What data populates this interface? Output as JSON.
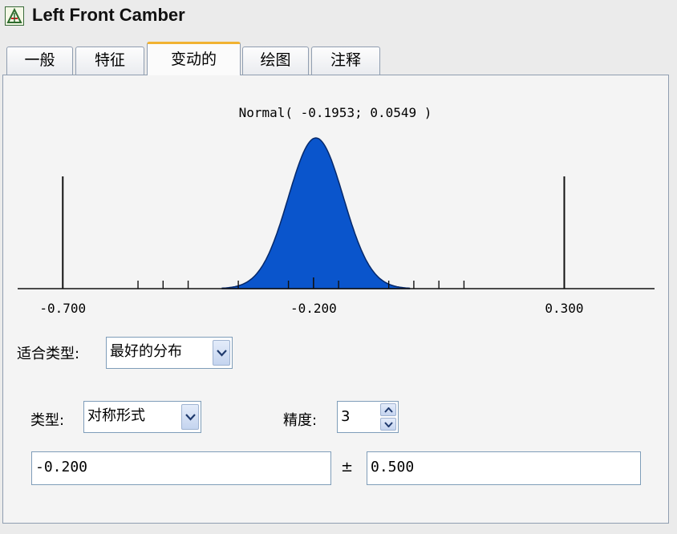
{
  "window": {
    "title": "Left Front Camber",
    "icon": "tolerance-chart-icon"
  },
  "tabs": [
    {
      "label": "一般",
      "active": false
    },
    {
      "label": "特征",
      "active": false
    },
    {
      "label": "变动的",
      "active": true
    },
    {
      "label": "绘图",
      "active": false
    },
    {
      "label": "注释",
      "active": false
    }
  ],
  "chart_data": {
    "type": "area",
    "title": "Normal( -0.1953; 0.0549 )",
    "distribution": "normal",
    "mean": -0.1953,
    "std": 0.0549,
    "x_range": [
      -0.79,
      0.48
    ],
    "tick_labels": [
      "-0.700",
      "-0.200",
      "0.300"
    ],
    "limits": [
      -0.7,
      0.3
    ],
    "minor_ticks": [
      -0.55,
      -0.5,
      -0.45,
      -0.35,
      -0.25,
      -0.15,
      -0.05,
      0.0,
      0.05,
      0.1
    ],
    "fill_color": "#0a55cc"
  },
  "form": {
    "fit_type_label": "适合类型:",
    "fit_type_value": "最好的分布",
    "type_label": "类型:",
    "type_value": "对称形式",
    "precision_label": "精度:",
    "precision_value": "3",
    "nominal_value": "-0.200",
    "plus_minus": "±",
    "tolerance_value": "0.500"
  },
  "colors": {
    "active_tab_accent": "#f1b232",
    "border": "#8f9db0",
    "curve_fill": "#0a55cc"
  }
}
